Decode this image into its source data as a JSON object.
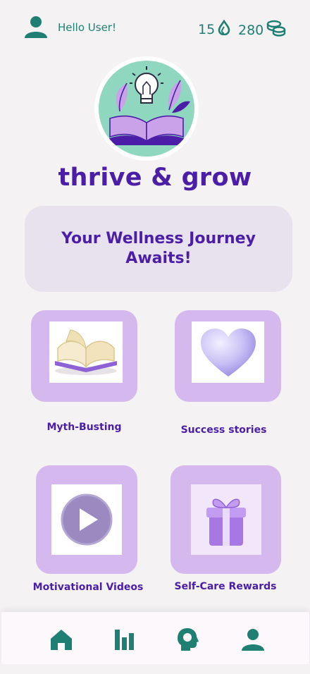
{
  "header": {
    "greeting": "Hello User!",
    "drops_count": "15",
    "coins_count": "280"
  },
  "brand": {
    "title": "thrive & grow"
  },
  "banner": {
    "text": "Your Wellness Journey Awaits!"
  },
  "cards": [
    {
      "label": "Myth-Busting",
      "icon": "open-book-icon"
    },
    {
      "label": "Success stories",
      "icon": "heart-icon"
    },
    {
      "label": "Motivational Videos",
      "icon": "play-icon"
    },
    {
      "label": "Self-Care Rewards",
      "icon": "gift-icon"
    }
  ],
  "nav": [
    {
      "icon": "home-icon"
    },
    {
      "icon": "stats-icon"
    },
    {
      "icon": "mind-icon"
    },
    {
      "icon": "profile-icon"
    }
  ],
  "colors": {
    "primary": "#4c1ea8",
    "accent": "#1e7f72",
    "tile": "#d5b9ee",
    "banner": "#e8e1ee",
    "background": "#f4f2f3"
  }
}
